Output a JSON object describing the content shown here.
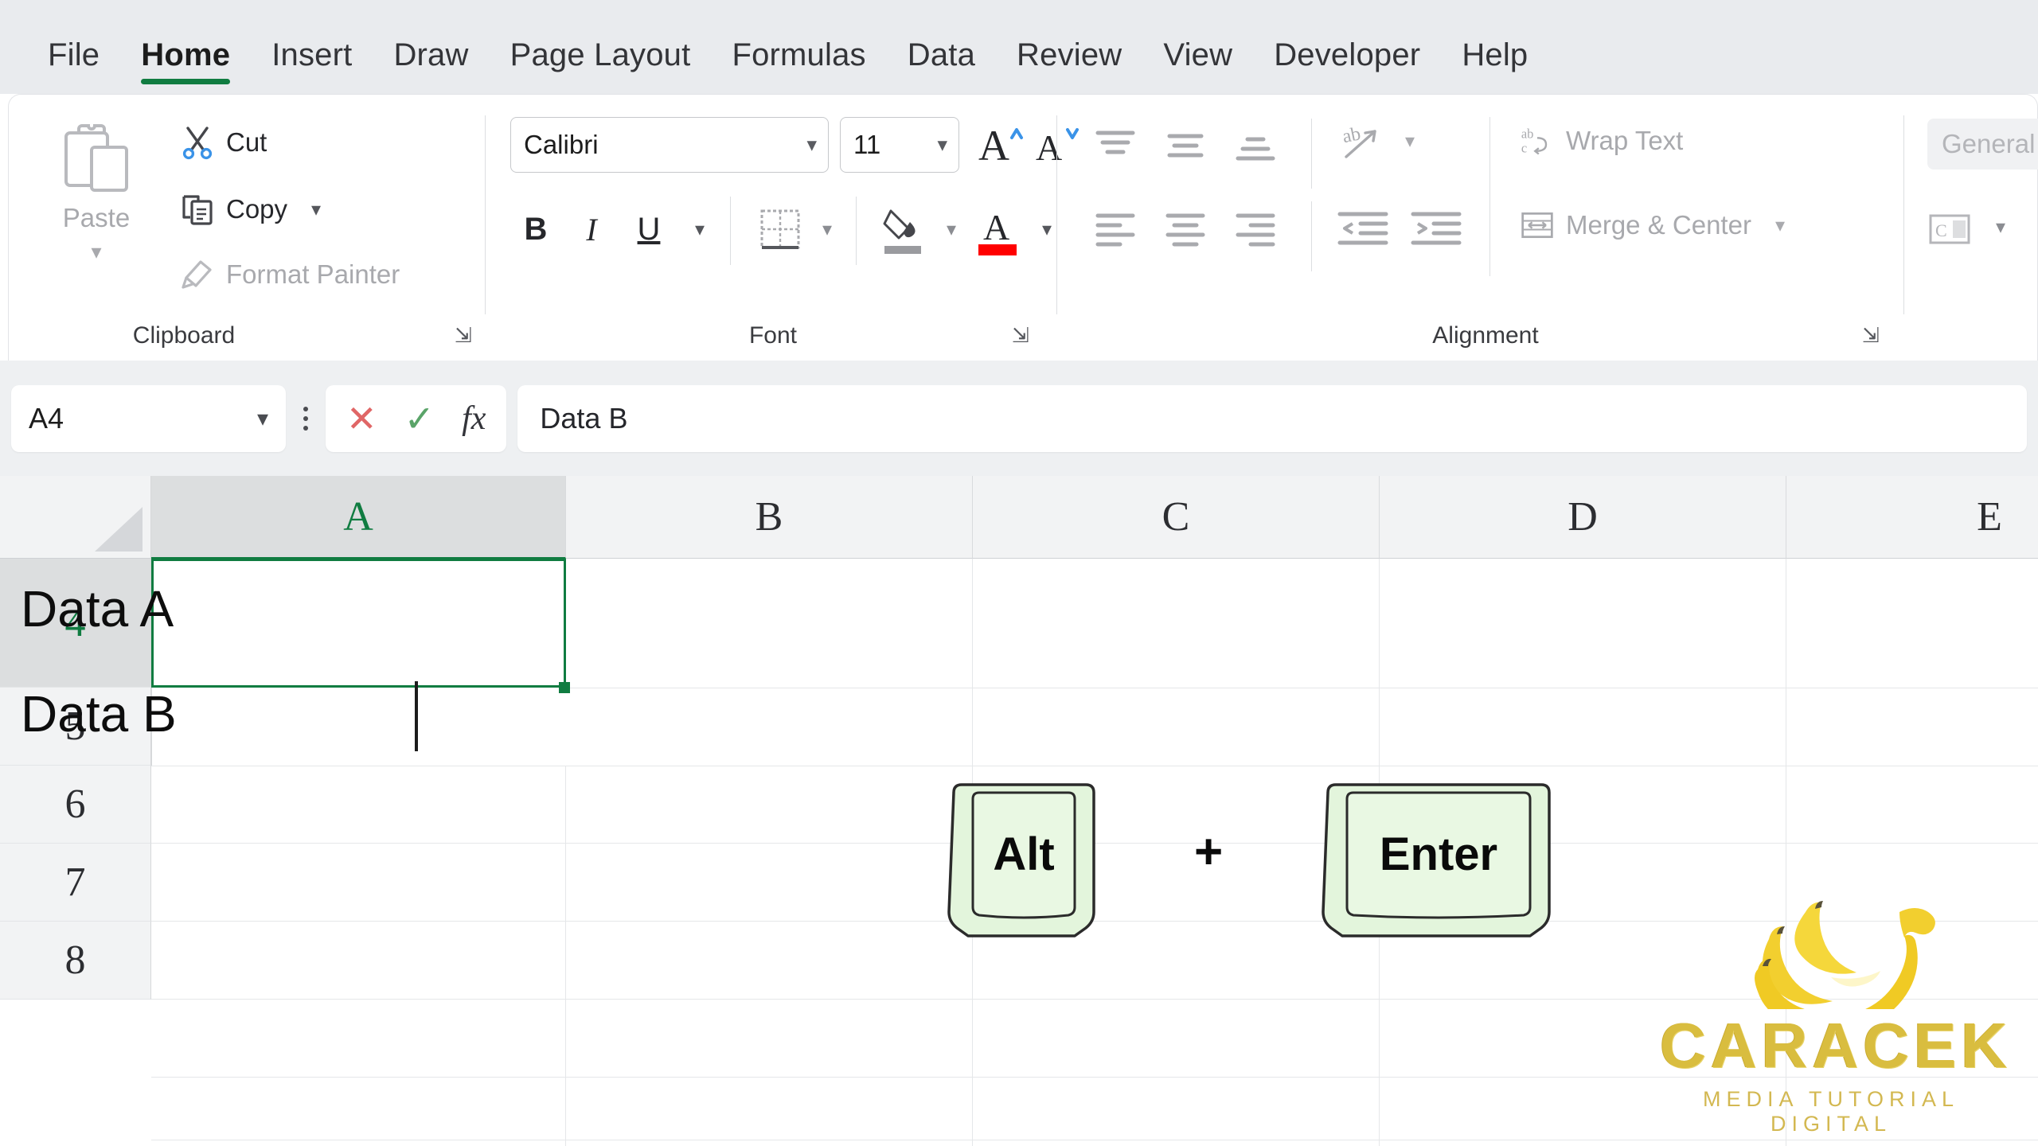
{
  "ribbon": {
    "tabs": [
      {
        "label": "File",
        "active": false
      },
      {
        "label": "Home",
        "active": true
      },
      {
        "label": "Insert",
        "active": false
      },
      {
        "label": "Draw",
        "active": false
      },
      {
        "label": "Page Layout",
        "active": false
      },
      {
        "label": "Formulas",
        "active": false
      },
      {
        "label": "Data",
        "active": false
      },
      {
        "label": "Review",
        "active": false
      },
      {
        "label": "View",
        "active": false
      },
      {
        "label": "Developer",
        "active": false
      },
      {
        "label": "Help",
        "active": false
      }
    ],
    "accent_color": "#107c41",
    "groups": {
      "clipboard": {
        "label": "Clipboard",
        "paste_label": "Paste",
        "cut_label": "Cut",
        "copy_label": "Copy",
        "format_painter_label": "Format Painter"
      },
      "font": {
        "label": "Font",
        "font_name": "Calibri",
        "font_size": "11",
        "grow_label": "A",
        "shrink_label": "A",
        "bold_label": "B",
        "italic_label": "I",
        "underline_label": "U",
        "font_color_swatch": "#ff0000"
      },
      "alignment": {
        "label": "Alignment",
        "wrap_text_label": "Wrap Text",
        "merge_center_label": "Merge & Center"
      },
      "number": {
        "format_value": "General"
      }
    }
  },
  "formula_bar": {
    "name_box_value": "A4",
    "cancel_label": "✕",
    "confirm_label": "✓",
    "fx_label": "fx",
    "formula_value": "Data B"
  },
  "grid": {
    "columns": [
      "A",
      "B",
      "C",
      "D",
      "E"
    ],
    "selected_column": "A",
    "rows": [
      "4",
      "5",
      "6",
      "7",
      "8"
    ],
    "selected_row": "4",
    "active_cell": "A4",
    "editing": true,
    "cell_lines": [
      "Data A",
      "Data B"
    ]
  },
  "overlay": {
    "key_left": "Alt",
    "key_separator": "+",
    "key_right": "Enter",
    "keycap_fill": "#e3f5dc"
  },
  "watermark": {
    "brand": "CARACEK",
    "tagline": "MEDIA TUTORIAL DIGITAL",
    "color": "#d9bd3f"
  }
}
